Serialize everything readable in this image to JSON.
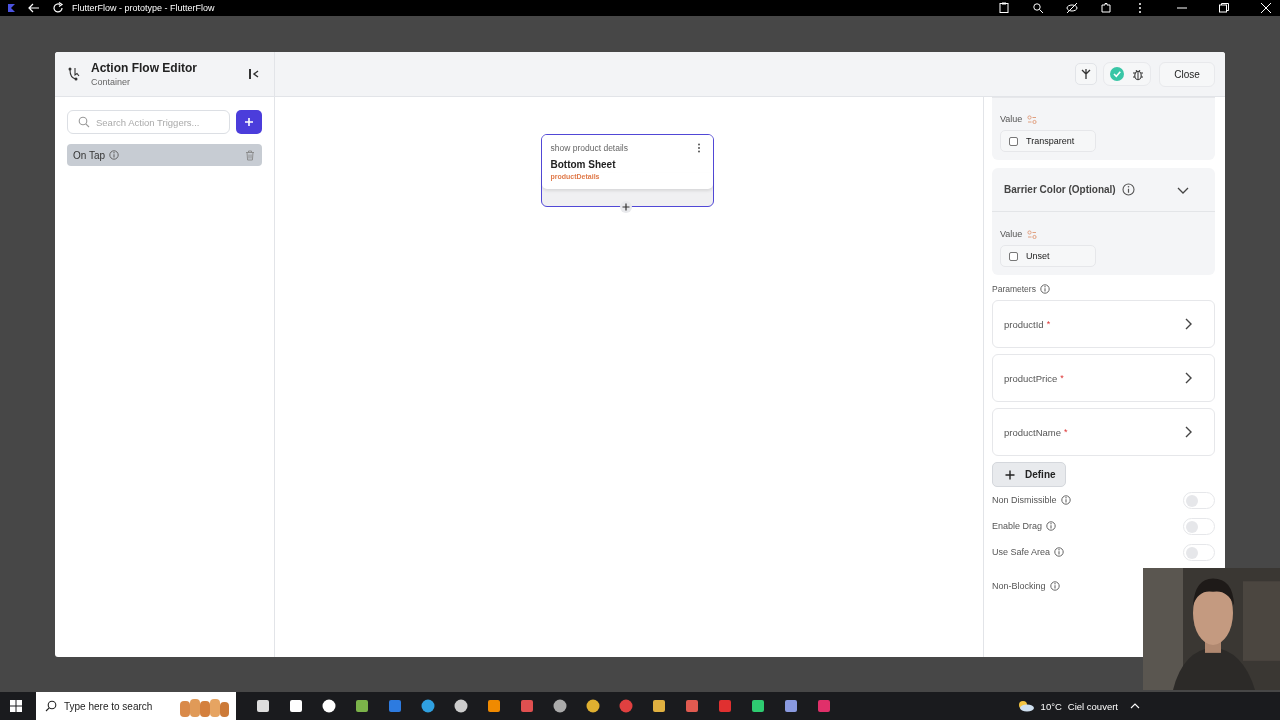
{
  "browser": {
    "title": "FlutterFlow - prototype - FlutterFlow"
  },
  "editor": {
    "title": "Action Flow Editor",
    "subtitle": "Container",
    "close_label": "Close",
    "valid": true
  },
  "triggers": {
    "search_placeholder": "Search Action Triggers...",
    "items": [
      {
        "label": "On Tap",
        "selected": true
      }
    ]
  },
  "canvas": {
    "nodes": [
      {
        "caption": "show product details",
        "title": "Bottom Sheet",
        "detail": "productDetails"
      }
    ]
  },
  "properties": {
    "cards": [
      {
        "value_label": "Value",
        "option": "Transparent",
        "checked": false
      },
      {
        "header": "Barrier Color (Optional)",
        "expanded": true,
        "value_label": "Value",
        "option": "Unset",
        "checked": false
      }
    ],
    "parameters_label": "Parameters",
    "parameters": [
      {
        "name": "productId",
        "mark": "*"
      },
      {
        "name": "productPrice",
        "mark": "*"
      },
      {
        "name": "productName",
        "mark": "*"
      }
    ],
    "define_label": "Define",
    "toggles": [
      {
        "label": "Non Dismissible",
        "on": false
      },
      {
        "label": "Enable Drag",
        "on": false
      },
      {
        "label": "Use Safe Area",
        "on": false
      },
      {
        "label": "Non-Blocking"
      }
    ]
  },
  "taskbar": {
    "search_placeholder": "Type here to search",
    "temperature": "10°C",
    "weather": "Ciel couvert"
  }
}
